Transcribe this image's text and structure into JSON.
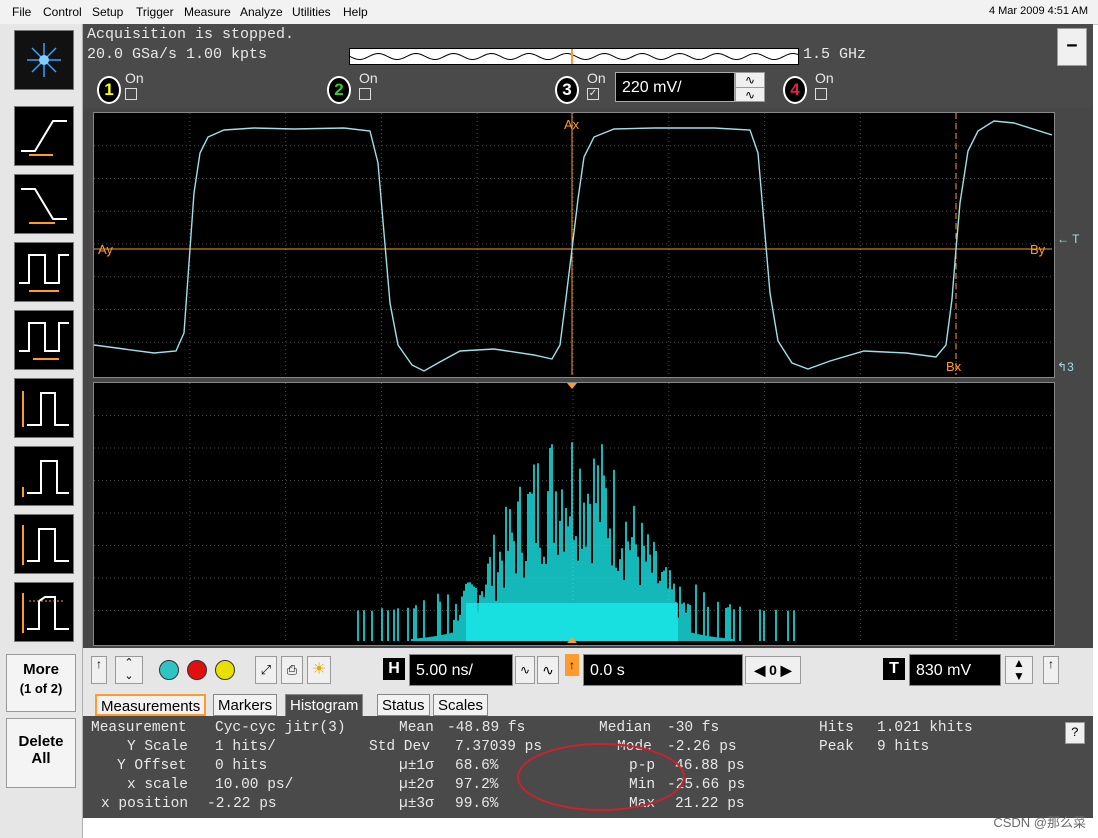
{
  "menu": {
    "items": [
      "File",
      "Control",
      "Setup",
      "Trigger",
      "Measure",
      "Analyze",
      "Utilities",
      "Help"
    ],
    "datetime": "4 Mar 2009  4:51 AM"
  },
  "acquisition": {
    "status": "Acquisition is stopped.",
    "rate": "20.0 GSa/s   1.00 kpts",
    "bandwidth": "1.5 GHz",
    "minimize_label": "–"
  },
  "channels": [
    {
      "num": "1",
      "label": "On",
      "checked": false,
      "color": "#ffff00",
      "check_mark": ""
    },
    {
      "num": "2",
      "label": "On",
      "checked": false,
      "color": "#33cc33",
      "check_mark": ""
    },
    {
      "num": "3",
      "label": "On",
      "checked": true,
      "color": "#3a3a3a",
      "check_mark": "✓",
      "scale": "220 mV/"
    },
    {
      "num": "4",
      "label": "On",
      "checked": false,
      "color": "#e0204a",
      "check_mark": ""
    }
  ],
  "markers": {
    "ax": "Ax",
    "ay": "Ay",
    "by": "By",
    "bx": "Bx",
    "t": "T",
    "three": "3"
  },
  "toolbar": {
    "more_label": "More",
    "more_sub": "(1 of 2)",
    "delete_label": "Delete",
    "delete_sub": "All"
  },
  "timebase": {
    "h_label": "H",
    "scale": "5.00 ns/",
    "delay": "0.0 s",
    "zero": "0",
    "t_label": "T",
    "trigger_level": "830 mV"
  },
  "tabs": [
    "Measurements",
    "Markers",
    "Histogram",
    "Status",
    "Scales"
  ],
  "active_tab": "Histogram",
  "measurement": {
    "measurement_label": "Measurement",
    "measurement_value": "Cyc-cyc jitr(3)",
    "y_scale_label": "Y Scale",
    "y_scale": "1 hits/",
    "y_offset_label": "Y Offset",
    "y_offset": "0 hits",
    "x_scale_label": "x scale",
    "x_scale": "10.00 ps/",
    "x_position_label": "x position",
    "x_position": "-2.22 ps",
    "mean_label": "Mean",
    "mean": "-48.89 fs",
    "std_dev_label": "Std Dev",
    "std_dev": "7.37039 ps",
    "sigma1_label": "µ±1σ",
    "sigma1": "68.6%",
    "sigma2_label": "µ±2σ",
    "sigma2": "97.2%",
    "sigma3_label": "µ±3σ",
    "sigma3": "99.6%",
    "median_label": "Median",
    "median": "-30 fs",
    "mode_label": "Mode",
    "mode": "-2.26 ps",
    "pp_label": "p-p",
    "pp": "46.88 ps",
    "min_label": "Min",
    "min": "-25.66 ps",
    "max_label": "Max",
    "max": "21.22 ps",
    "hits_label": "Hits",
    "hits": "1.021 khits",
    "peak_label": "Peak",
    "peak": "9 hits",
    "help": "?"
  },
  "colors": {
    "trace": "#9fdfe6",
    "histogram": "#19e6e6",
    "marker": "#ff9a2e",
    "grid": "#4d4d4d",
    "highlight": "#d0202a"
  },
  "watermark": "CSDN @那么菜"
}
